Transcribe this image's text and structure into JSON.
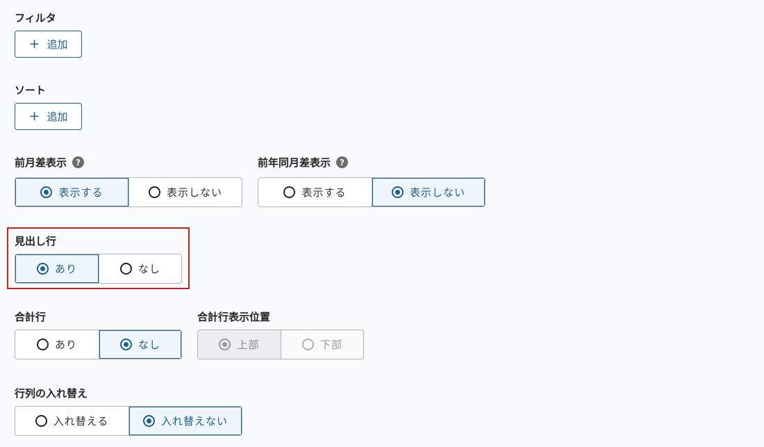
{
  "filter": {
    "label": "フィルタ",
    "add_label": "追加",
    "add_icon": "plus-icon"
  },
  "sort": {
    "label": "ソート",
    "add_label": "追加",
    "add_icon": "plus-icon"
  },
  "prev_month_diff": {
    "label": "前月差表示",
    "help_icon": "question-icon",
    "options": [
      {
        "label": "表示する",
        "selected": true
      },
      {
        "label": "表示しない",
        "selected": false
      }
    ]
  },
  "prev_year_diff": {
    "label": "前年同月差表示",
    "help_icon": "question-icon",
    "options": [
      {
        "label": "表示する",
        "selected": false
      },
      {
        "label": "表示しない",
        "selected": true
      }
    ]
  },
  "header_row": {
    "label": "見出し行",
    "highlighted": true,
    "highlight_color": "#cc1f1f",
    "options": [
      {
        "label": "あり",
        "selected": true
      },
      {
        "label": "なし",
        "selected": false
      }
    ]
  },
  "total_row": {
    "label": "合計行",
    "options": [
      {
        "label": "あり",
        "selected": false
      },
      {
        "label": "なし",
        "selected": true
      }
    ]
  },
  "total_row_position": {
    "label": "合計行表示位置",
    "disabled": true,
    "options": [
      {
        "label": "上部",
        "selected": true
      },
      {
        "label": "下部",
        "selected": false
      }
    ]
  },
  "transpose": {
    "label": "行列の入れ替え",
    "options": [
      {
        "label": "入れ替える",
        "selected": false
      },
      {
        "label": "入れ替えない",
        "selected": true
      }
    ]
  },
  "colors": {
    "accent": "#1f5f8b",
    "selected_bg": "#eef6fc",
    "highlight": "#cc1f1f"
  }
}
